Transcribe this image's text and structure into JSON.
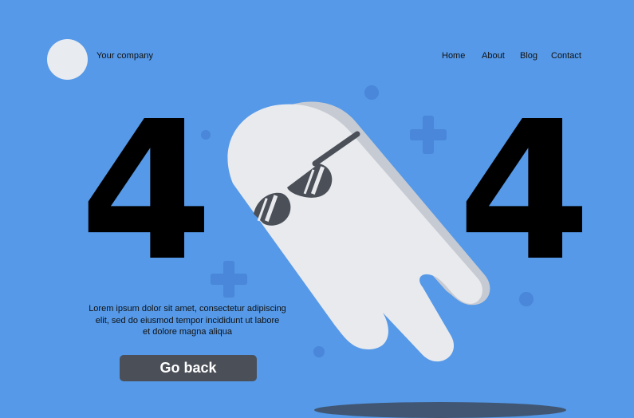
{
  "header": {
    "company_name": "Your company",
    "nav": [
      {
        "label": "Home"
      },
      {
        "label": "About"
      },
      {
        "label": "Blog"
      },
      {
        "label": "Contact"
      }
    ]
  },
  "hero": {
    "digit_left": "4",
    "digit_right": "4",
    "description_lines": [
      "Lorem ipsum dolor sit amet, consectetur adipiscing",
      "elit, sed do eiusmod tempor incididunt ut labore",
      "et dolore magna aliqua"
    ],
    "button_label": "Go back"
  },
  "colors": {
    "background": "#5599e8",
    "decor": "#4a86d9",
    "ghost": "#e9eaee",
    "ghost_shade": "#c6cad2",
    "glasses": "#4a4f58",
    "button": "#4a4f58"
  },
  "icons": [
    "logo-circle",
    "plus-icon",
    "dot-icon",
    "ghost-illustration",
    "sunglasses-icon"
  ]
}
